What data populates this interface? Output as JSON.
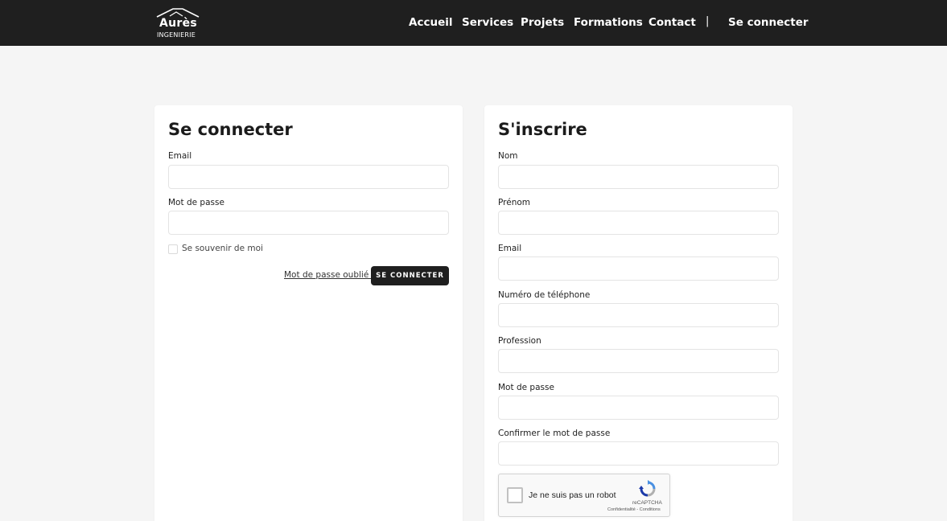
{
  "header": {
    "logo_name": "Aurès",
    "logo_sub": "INGENIERIE",
    "nav": [
      {
        "label": "Accueil"
      },
      {
        "label": "Services"
      },
      {
        "label": "Projets"
      },
      {
        "label": "Formations"
      },
      {
        "label": "Contact"
      }
    ],
    "separator": "|",
    "login_link": "Se connecter"
  },
  "login": {
    "title": "Se connecter",
    "fields": [
      {
        "label": "Email",
        "value": ""
      },
      {
        "label": "Mot de passe",
        "value": ""
      }
    ],
    "remember_label": "Se souvenir de moi",
    "remember_checked": false,
    "forgot_link": "Mot de passe oublié ?",
    "submit_label": "SE CONNECTER"
  },
  "signup": {
    "title": "S'inscrire",
    "fields": [
      {
        "label": "Nom",
        "value": ""
      },
      {
        "label": "Prénom",
        "value": ""
      },
      {
        "label": "Email",
        "value": ""
      },
      {
        "label": "Numéro de téléphone",
        "value": ""
      },
      {
        "label": "Profession",
        "value": ""
      },
      {
        "label": "Mot de passe",
        "value": ""
      },
      {
        "label": "Confirmer le mot de passe",
        "value": ""
      }
    ],
    "captcha": {
      "label": "Je ne suis pas un robot",
      "brand": "reCAPTCHA",
      "terms": "Confidentialité - Conditions",
      "checked": false
    }
  },
  "colors": {
    "header_bg": "#1f1f1f",
    "page_bg": "#f5f5f5",
    "card_bg": "#ffffff",
    "button_bg": "#1f1f1f"
  }
}
